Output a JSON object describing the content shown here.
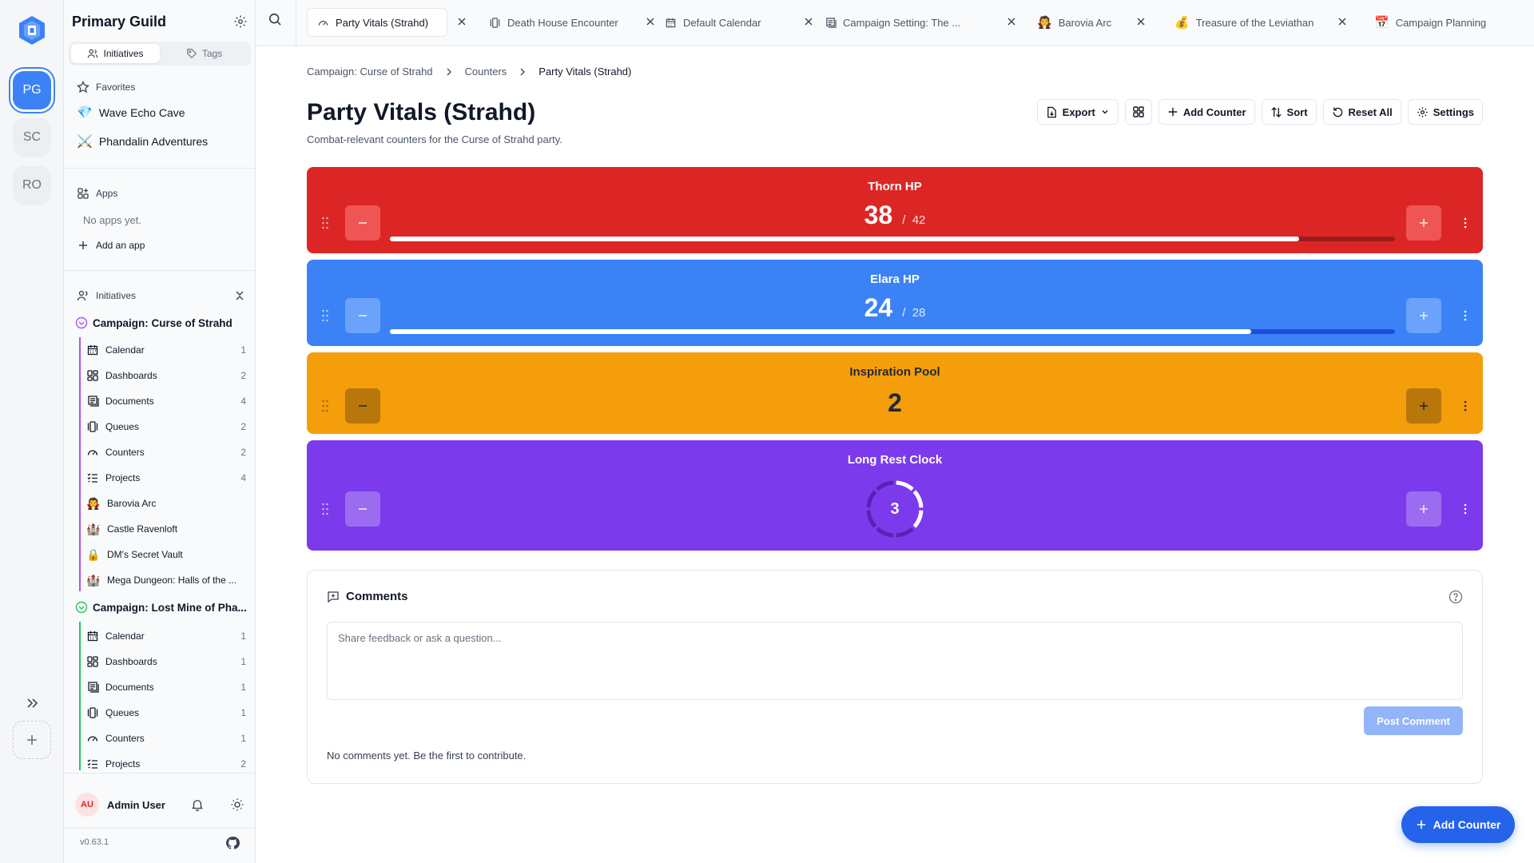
{
  "colors": {
    "accent": "#3b82f6",
    "thorn": "#dc2626",
    "elara": "#3b82f6",
    "inspiration": "#f59e0b",
    "long_rest": "#7c3aed"
  },
  "rail": {
    "avatars": [
      {
        "label": "PG",
        "active": true
      },
      {
        "label": "SC",
        "active": false
      },
      {
        "label": "RO",
        "active": false
      }
    ]
  },
  "sidebar": {
    "title": "Primary Guild",
    "tabs": [
      {
        "label": "Initiatives",
        "icon": "users-icon"
      },
      {
        "label": "Tags",
        "icon": "tag-icon"
      }
    ],
    "favorites_label": "Favorites",
    "favorites": [
      {
        "label": "Wave Echo Cave",
        "icon": "💎"
      },
      {
        "label": "Phandalin Adventures",
        "icon": "⚔️"
      }
    ],
    "apps_label": "Apps",
    "no_apps": "No apps yet.",
    "add_app": "Add an app",
    "initiatives_label": "Initiatives",
    "campaigns": [
      {
        "name": "Campaign: Curse of Strahd",
        "items": [
          {
            "label": "Calendar",
            "count": "1",
            "icon": "calendar-icon"
          },
          {
            "label": "Dashboards",
            "count": "2",
            "icon": "dashboard-icon"
          },
          {
            "label": "Documents",
            "count": "4",
            "icon": "document-icon"
          },
          {
            "label": "Queues",
            "count": "2",
            "icon": "queue-icon"
          },
          {
            "label": "Counters",
            "count": "2",
            "icon": "gauge-icon"
          },
          {
            "label": "Projects",
            "count": "4",
            "icon": "checklist-icon"
          },
          {
            "label": "Barovia Arc",
            "count": "",
            "emoji": "🧛"
          },
          {
            "label": "Castle Ravenloft",
            "count": "",
            "emoji": "🏰"
          },
          {
            "label": "DM's Secret Vault",
            "count": "",
            "emoji": "🔒"
          },
          {
            "label": "Mega Dungeon: Halls of the ...",
            "count": "",
            "emoji": "🏰"
          }
        ]
      },
      {
        "name": "Campaign: Lost Mine of Pha...",
        "items": [
          {
            "label": "Calendar",
            "count": "1",
            "icon": "calendar-icon"
          },
          {
            "label": "Dashboards",
            "count": "1",
            "icon": "dashboard-icon"
          },
          {
            "label": "Documents",
            "count": "1",
            "icon": "document-icon"
          },
          {
            "label": "Queues",
            "count": "1",
            "icon": "queue-icon"
          },
          {
            "label": "Counters",
            "count": "1",
            "icon": "gauge-icon"
          },
          {
            "label": "Projects",
            "count": "2",
            "icon": "checklist-icon"
          }
        ]
      }
    ],
    "user": {
      "initials": "AU",
      "name": "Admin User"
    },
    "version": "v0.63.1"
  },
  "tabs": [
    {
      "label": "Party Vitals (Strahd)",
      "icon": "gauge-icon",
      "active": true
    },
    {
      "label": "Death House Encounter",
      "icon": "queue-icon",
      "active": false
    },
    {
      "label": "Default Calendar",
      "icon": "calendar-icon",
      "active": false
    },
    {
      "label": "Campaign Setting: The ...",
      "icon": "document-icon",
      "active": false
    },
    {
      "label": "Barovia Arc",
      "icon": "🧛",
      "active": false
    },
    {
      "label": "Treasure of the Leviathan",
      "icon": "💰",
      "active": false
    },
    {
      "label": "Campaign Planning",
      "icon": "📅",
      "active": false
    }
  ],
  "breadcrumb": [
    "Campaign: Curse of Strahd",
    "Counters",
    "Party Vitals (Strahd)"
  ],
  "page": {
    "title": "Party Vitals (Strahd)",
    "subtitle": "Combat-relevant counters for the Curse of Strahd party."
  },
  "toolbar": {
    "export": "Export",
    "add_counter": "Add Counter",
    "sort": "Sort",
    "reset_all": "Reset All",
    "settings": "Settings"
  },
  "counters": [
    {
      "title": "Thorn HP",
      "value": "38",
      "max": "42",
      "progress": 0.905
    },
    {
      "title": "Elara HP",
      "value": "24",
      "max": "28",
      "progress": 0.857
    },
    {
      "title": "Inspiration Pool",
      "value": "2"
    },
    {
      "title": "Long Rest Clock",
      "value": "3",
      "clock_segments": 8,
      "clock_filled": 3
    }
  ],
  "comments": {
    "title": "Comments",
    "placeholder": "Share feedback or ask a question...",
    "post": "Post Comment",
    "empty": "No comments yet. Be the first to contribute."
  },
  "fab": {
    "label": "Add Counter"
  }
}
